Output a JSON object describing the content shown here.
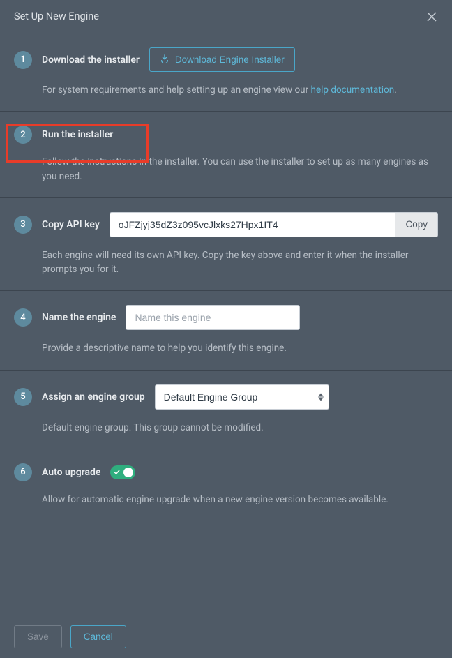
{
  "header": {
    "title": "Set Up New Engine"
  },
  "steps": {
    "s1": {
      "num": "1",
      "title": "Download the installer",
      "download_label": "Download Engine Installer",
      "desc_pre": "For system requirements and help setting up an engine view our ",
      "help_link": "help documentation",
      "desc_post": "."
    },
    "s2": {
      "num": "2",
      "title": "Run the installer",
      "desc": "Follow the instructions in the installer. You can use the installer to set up as many engines as you need."
    },
    "s3": {
      "num": "3",
      "title": "Copy API key",
      "api_key": "oJFZjyj35dZ3z095vcJlxks27Hpx1IT4",
      "copy_label": "Copy",
      "desc": "Each engine will need its own API key. Copy the key above and enter it when the installer prompts you for it."
    },
    "s4": {
      "num": "4",
      "title": "Name the engine",
      "placeholder": "Name this engine",
      "desc": "Provide a descriptive name to help you identify this engine."
    },
    "s5": {
      "num": "5",
      "title": "Assign an engine group",
      "selected": "Default Engine Group",
      "desc": "Default engine group. This group cannot be modified."
    },
    "s6": {
      "num": "6",
      "title": "Auto upgrade",
      "desc": "Allow for automatic engine upgrade when a new engine version becomes available."
    }
  },
  "footer": {
    "save": "Save",
    "cancel": "Cancel"
  }
}
